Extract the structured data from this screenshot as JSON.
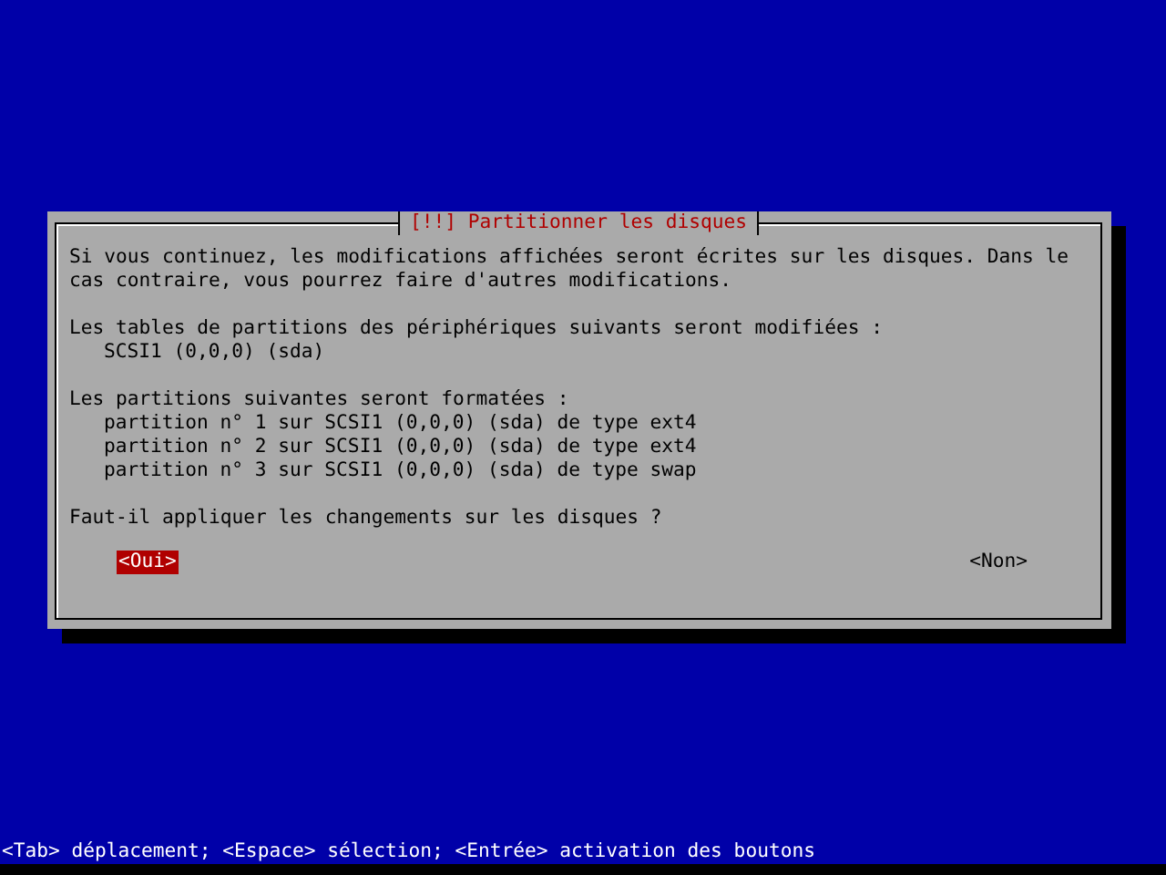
{
  "dialog": {
    "title": "[!!] Partitionner les disques",
    "paragraphs": [
      {
        "lines": [
          "Si vous continuez, les modifications affichées seront écrites sur les disques. Dans le",
          "cas contraire, vous pourrez faire d'autres modifications."
        ]
      },
      {
        "lines": [
          "Les tables de partitions des périphériques suivants seront modifiées :"
        ],
        "items": [
          "SCSI1 (0,0,0) (sda)"
        ]
      },
      {
        "lines": [
          "Les partitions suivantes seront formatées :"
        ],
        "items": [
          "partition n° 1 sur SCSI1 (0,0,0) (sda) de type ext4",
          "partition n° 2 sur SCSI1 (0,0,0) (sda) de type ext4",
          "partition n° 3 sur SCSI1 (0,0,0) (sda) de type swap"
        ]
      },
      {
        "lines": [
          "Faut-il appliquer les changements sur les disques ?"
        ]
      }
    ],
    "buttons": [
      {
        "label": "<Oui>",
        "selected": true
      },
      {
        "label": "<Non>",
        "selected": false
      }
    ]
  },
  "status_bar": "<Tab> déplacement; <Espace> sélection; <Entrée> activation des boutons"
}
